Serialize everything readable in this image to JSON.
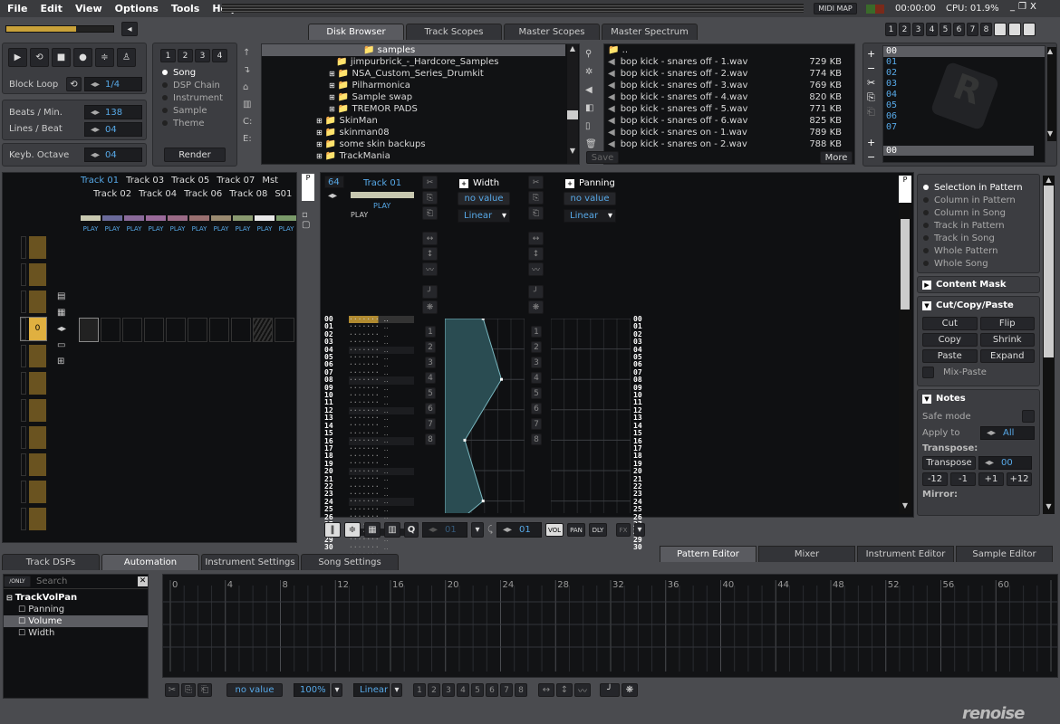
{
  "menu": [
    "File",
    "Edit",
    "View",
    "Options",
    "Tools",
    "Help"
  ],
  "topbar": {
    "midi_map": "MIDI MAP",
    "time": "00:00:00",
    "cpu": "CPU: 01.9%"
  },
  "upper_tabs": [
    {
      "label": "Disk Browser",
      "active": true
    },
    {
      "label": "Track Scopes"
    },
    {
      "label": "Master Scopes"
    },
    {
      "label": "Master Spectrum"
    }
  ],
  "layout_buttons": [
    "1",
    "2",
    "3",
    "4",
    "5",
    "6",
    "7",
    "8"
  ],
  "transport": {
    "block_loop_label": "Block Loop",
    "block_loop_value": "1/4",
    "bpm_label": "Beats / Min.",
    "bpm": "138",
    "lpb_label": "Lines / Beat",
    "lpb": "04",
    "octave_label": "Keyb. Octave",
    "octave": "04"
  },
  "render_panel": {
    "presets": [
      "1",
      "2",
      "3",
      "4"
    ],
    "options": [
      {
        "label": "Song",
        "selected": true
      },
      {
        "label": "DSP Chain"
      },
      {
        "label": "Instrument"
      },
      {
        "label": "Sample"
      },
      {
        "label": "Theme"
      }
    ],
    "render_label": "Render"
  },
  "folders": {
    "current": "samples",
    "items": [
      {
        "name": "jimpurbrick_-_Hardcore_Samples",
        "depth": 2,
        "expand": false
      },
      {
        "name": "NSA_Custom_Series_Drumkit",
        "depth": 2,
        "expand": true
      },
      {
        "name": "Pilharmonica",
        "depth": 2,
        "expand": true
      },
      {
        "name": "Sample swap",
        "depth": 2,
        "expand": true
      },
      {
        "name": "TREMOR PADS",
        "depth": 2,
        "expand": true
      },
      {
        "name": "SkinMan",
        "depth": 1,
        "expand": true
      },
      {
        "name": "skinman08",
        "depth": 1,
        "expand": true
      },
      {
        "name": "some skin backups",
        "depth": 1,
        "expand": true
      },
      {
        "name": "TrackMania",
        "depth": 1,
        "expand": true
      }
    ],
    "drives": [
      "C:",
      "E:"
    ]
  },
  "files": {
    "parent": "..",
    "items": [
      {
        "name": "bop kick - snares off - 1.wav",
        "size": "729 KB"
      },
      {
        "name": "bop kick - snares off - 2.wav",
        "size": "774 KB"
      },
      {
        "name": "bop kick - snares off - 3.wav",
        "size": "769 KB"
      },
      {
        "name": "bop kick - snares off - 4.wav",
        "size": "820 KB"
      },
      {
        "name": "bop kick - snares off - 5.wav",
        "size": "771 KB"
      },
      {
        "name": "bop kick - snares off - 6.wav",
        "size": "825 KB"
      },
      {
        "name": "bop kick - snares on - 1.wav",
        "size": "789 KB"
      },
      {
        "name": "bop kick - snares on - 2.wav",
        "size": "788 KB"
      }
    ],
    "save_label": "Save",
    "more_label": "More"
  },
  "sequencer": {
    "positions": [
      "00",
      "01",
      "02",
      "03",
      "04",
      "05",
      "06",
      "07"
    ],
    "bottom": "00"
  },
  "matrix": {
    "tracks_top": [
      "Track 01",
      "Track 03",
      "Track 05",
      "Track 07",
      "Mst"
    ],
    "tracks_bottom": [
      "Track 02",
      "Track 04",
      "Track 06",
      "Track 08",
      "S01"
    ],
    "play": "PLAY",
    "track_colors": [
      "#c8c8b0",
      "#6a6a9a",
      "#8a6a9a",
      "#9a6a9a",
      "#9a6a86",
      "#9a7070",
      "#9a8a70",
      "#8a9a70",
      "#e8e8e8",
      "#7a9a6a"
    ],
    "current_pattern": "0"
  },
  "pattern": {
    "lines": "64",
    "track_name": "Track 01",
    "play": "PLAY",
    "rows": [
      "00",
      "01",
      "02",
      "03",
      "04",
      "05",
      "06",
      "07",
      "08",
      "09",
      "10",
      "11",
      "12",
      "13",
      "14",
      "15",
      "16",
      "17",
      "18",
      "19",
      "20",
      "21",
      "22",
      "23",
      "24",
      "25",
      "26",
      "27",
      "28",
      "29",
      "30"
    ],
    "width_env": {
      "name": "Width",
      "value": "no value",
      "mode": "Linear",
      "points": [
        [
          0,
          0.48
        ],
        [
          8,
          0.71
        ],
        [
          16,
          0.25
        ],
        [
          24,
          0.48
        ],
        [
          28,
          0.02
        ]
      ]
    },
    "pan_env": {
      "name": "Panning",
      "value": "no value",
      "mode": "Linear"
    },
    "env_numbers": [
      "1",
      "2",
      "3",
      "4",
      "5",
      "6",
      "7",
      "8"
    ]
  },
  "pattern_toolbar": {
    "step": "01",
    "edit_step": "01",
    "vol": "VOL",
    "pan": "PAN",
    "dly": "DLY",
    "fx": "FX"
  },
  "advanced_edit": {
    "scopes": [
      {
        "label": "Selection in Pattern",
        "selected": true
      },
      {
        "label": "Column in Pattern"
      },
      {
        "label": "Column in Song"
      },
      {
        "label": "Track in Pattern"
      },
      {
        "label": "Track in Song"
      },
      {
        "label": "Whole Pattern"
      },
      {
        "label": "Whole Song"
      }
    ],
    "content_mask": "Content Mask",
    "ccp": "Cut/Copy/Paste",
    "buttons": [
      "Cut",
      "Flip",
      "Copy",
      "Shrink",
      "Paste",
      "Expand"
    ],
    "mix_paste": "Mix-Paste",
    "notes": "Notes",
    "safe_mode": "Safe mode",
    "apply_to": "Apply to",
    "apply_value": "All",
    "transpose_header": "Transpose:",
    "transpose": "Transpose",
    "transpose_value": "00",
    "steps": [
      "-12",
      "-1",
      "+1",
      "+12"
    ],
    "mirror": "Mirror:"
  },
  "lower_tabs": [
    {
      "label": "Track DSPs"
    },
    {
      "label": "Automation",
      "active": true
    },
    {
      "label": "Instrument Settings"
    },
    {
      "label": "Song Settings"
    }
  ],
  "editor_tabs": [
    {
      "label": "Pattern Editor",
      "active": true
    },
    {
      "label": "Mixer"
    },
    {
      "label": "Instrument Editor"
    },
    {
      "label": "Sample Editor"
    }
  ],
  "automation": {
    "search_placeholder": "Search",
    "only": "ONLY",
    "device": "TrackVolPan",
    "params": [
      {
        "label": "Panning"
      },
      {
        "label": "Volume",
        "selected": true
      },
      {
        "label": "Width"
      }
    ],
    "ruler": [
      "0",
      "4",
      "8",
      "12",
      "16",
      "20",
      "24",
      "28",
      "32",
      "36",
      "40",
      "44",
      "48",
      "52",
      "56",
      "60"
    ],
    "value": "no value",
    "zoom": "100%",
    "mode": "Linear",
    "numbers": [
      "1",
      "2",
      "3",
      "4",
      "5",
      "6",
      "7",
      "8"
    ]
  },
  "logo": "renoise"
}
